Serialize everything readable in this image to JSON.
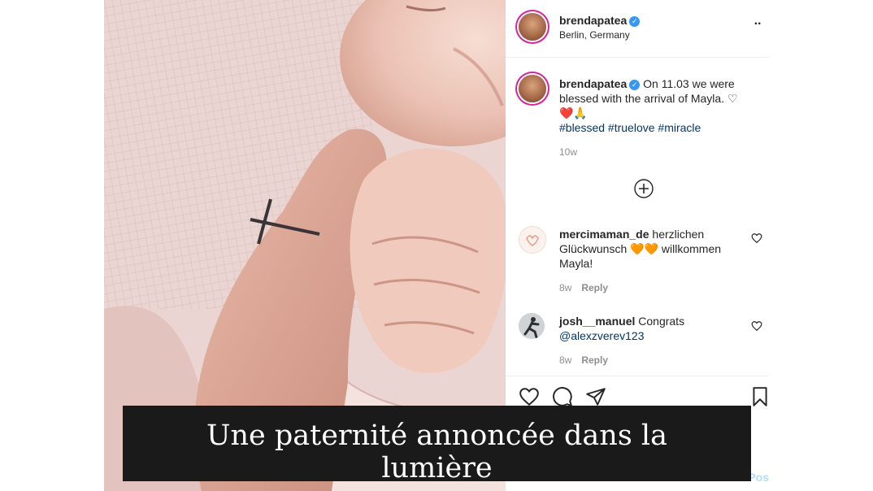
{
  "post": {
    "username": "brendapatea",
    "verified_mark": "✓",
    "location": "Berlin, Germany",
    "more_label": "··"
  },
  "caption": {
    "username": "brendapatea",
    "text": "On 11.03 we were blessed with the arrival of Mayla. ♡",
    "emoji": "❤️🙏",
    "hashtags": "#blessed #truelove #miracle",
    "time": "10w"
  },
  "comments": [
    {
      "username": "mercimaman_de",
      "text_start": "herzlichen Glückwunsch",
      "emoji": "🧡🧡",
      "text_end": "willkommen Mayla!",
      "time": "8w",
      "reply_label": "Reply"
    },
    {
      "username": "josh__manuel",
      "text": "Congrats",
      "mention": "@alexzverev123",
      "time": "8w",
      "reply_label": "Reply"
    }
  ],
  "actions": {
    "post_label": "Pos"
  },
  "overlay": {
    "title": "Une paternité annoncée dans la lumière"
  },
  "icons": {
    "load_more": "plus-circle-icon",
    "like": "heart-icon",
    "comment": "comment-icon",
    "share": "send-icon",
    "save": "bookmark-icon"
  },
  "colors": {
    "link": "#00376b",
    "verified": "#3897f0",
    "muted": "#8e8e8e",
    "overlay_bg": "#1a1a1a"
  }
}
